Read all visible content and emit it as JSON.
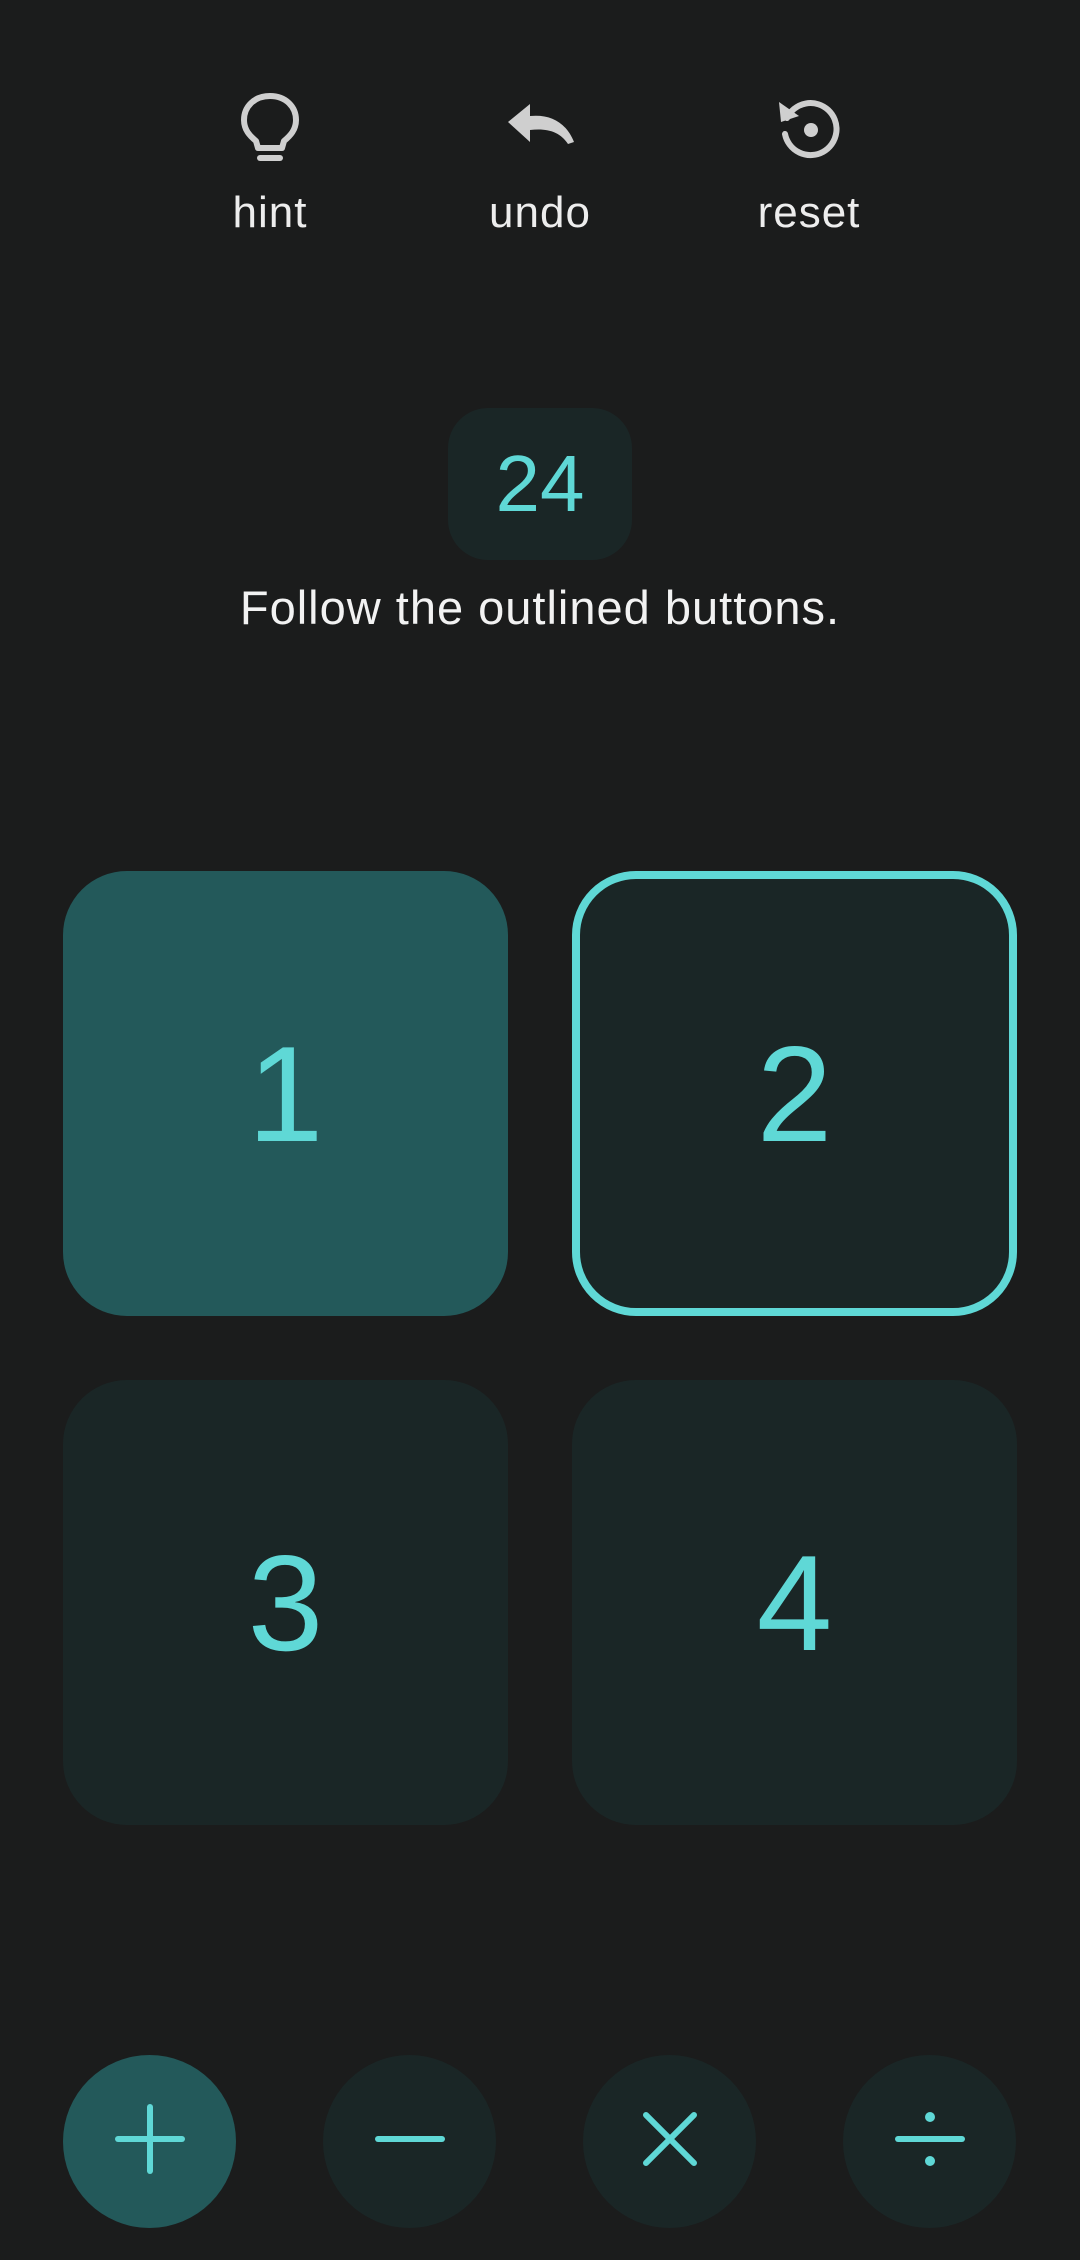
{
  "toolbar": {
    "hint": {
      "label": "hint",
      "icon": "lightbulb-icon"
    },
    "undo": {
      "label": "undo",
      "icon": "undo-icon"
    },
    "reset": {
      "label": "reset",
      "icon": "reset-icon"
    }
  },
  "target": {
    "value": "24"
  },
  "instruction": "Follow the outlined buttons.",
  "tiles": [
    {
      "value": "1",
      "state": "selected"
    },
    {
      "value": "2",
      "state": "outlined"
    },
    {
      "value": "3",
      "state": "default"
    },
    {
      "value": "4",
      "state": "default"
    }
  ],
  "operators": [
    {
      "symbol": "+",
      "icon": "plus-icon",
      "state": "selected"
    },
    {
      "symbol": "−",
      "icon": "minus-icon",
      "state": "default"
    },
    {
      "symbol": "×",
      "icon": "multiply-icon",
      "state": "default"
    },
    {
      "symbol": "÷",
      "icon": "divide-icon",
      "state": "default"
    }
  ],
  "colors": {
    "background": "#1b1c1c",
    "accent": "#5fd8d6",
    "tile": "#1a2626",
    "tile_selected": "#23595a",
    "toolbar_icon": "#cfcfcf"
  }
}
